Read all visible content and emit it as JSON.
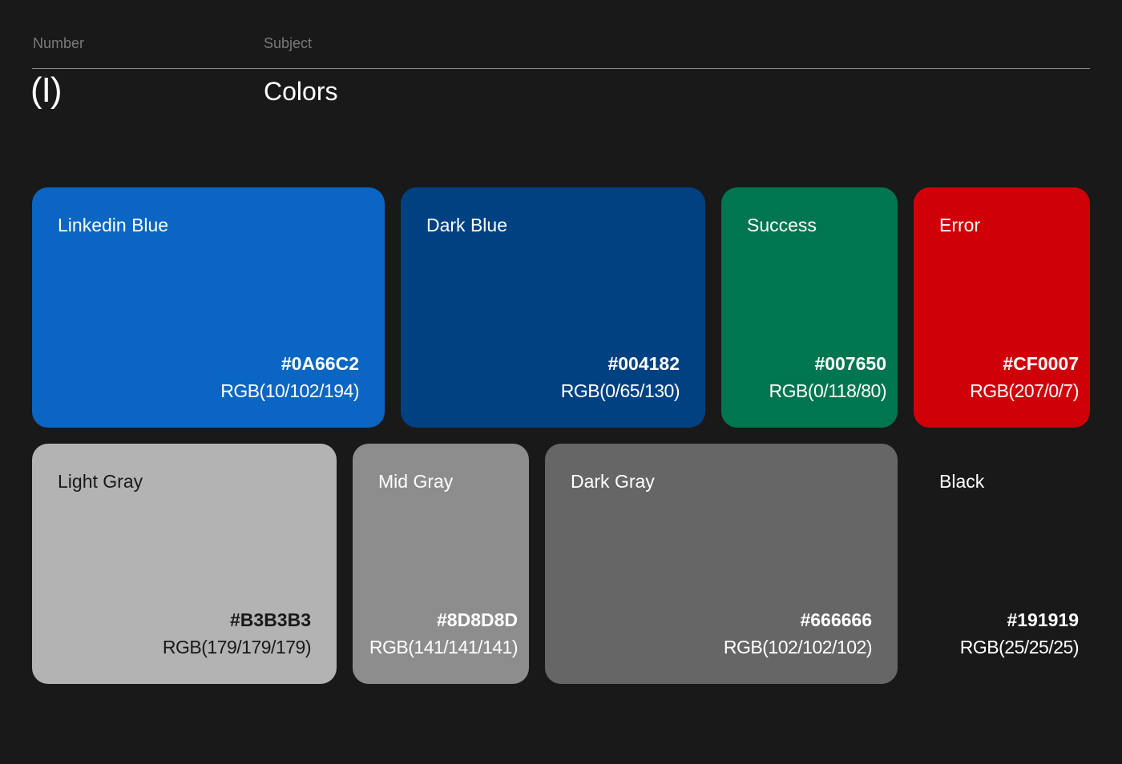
{
  "header": {
    "number_label": "Number",
    "subject_label": "Subject",
    "number_value": "(I)",
    "subject_value": "Colors"
  },
  "swatches": [
    {
      "name": "Linkedin Blue",
      "hex": "#0A66C2",
      "rgb": "RGB(10/102/194)",
      "color": "#0A66C2"
    },
    {
      "name": "Dark Blue",
      "hex": "#004182",
      "rgb": "RGB(0/65/130)",
      "color": "#004182"
    },
    {
      "name": "Success",
      "hex": "#007650",
      "rgb": "RGB(0/118/80)",
      "color": "#007650"
    },
    {
      "name": "Error",
      "hex": "#CF0007",
      "rgb": "RGB(207/0/7)",
      "color": "#CF0007"
    },
    {
      "name": "Light Gray",
      "hex": "#B3B3B3",
      "rgb": "RGB(179/179/179)",
      "color": "#B3B3B3"
    },
    {
      "name": "Mid Gray",
      "hex": "#8D8D8D",
      "rgb": "RGB(141/141/141)",
      "color": "#8D8D8D"
    },
    {
      "name": "Dark Gray",
      "hex": "#666666",
      "rgb": "RGB(102/102/102)",
      "color": "#666666"
    },
    {
      "name": "Black",
      "hex": "#191919",
      "rgb": "RGB(25/25/25)",
      "color": "#191919"
    }
  ]
}
